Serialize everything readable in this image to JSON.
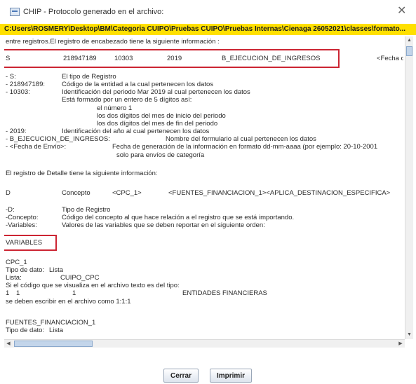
{
  "window": {
    "title": "CHIP - Protocolo generado en el archivo:",
    "path": "C:Users\\ROSMERY\\Desktop\\BM\\Categoria CUIPO\\Pruebas CUIPO\\Pruebas Internas\\Cienaga 26052021\\classes\\formato..."
  },
  "content": {
    "intro": "entre registros.El registro de encabezado tiene la siguiente información :",
    "header_record": {
      "c1": "S",
      "c2": "218947189",
      "c3": "10303",
      "c4": "2019",
      "c5": "B_EJECUCION_DE_INGRESOS",
      "c6": "<Fecha d"
    },
    "header_fields": [
      {
        "key": "- S:",
        "desc": "El tipo de Registro"
      },
      {
        "key": "- 218947189:",
        "desc": "Código de la entidad a la cual pertenecen los datos"
      },
      {
        "key": "- 10303:",
        "desc": "Identificación del periodo Mar 2019 al cual pertenecen los datos"
      }
    ],
    "period_note": {
      "line1": "Está formado por un entero de 5 dígitos así:",
      "line2": "el número 1",
      "line3": "los dos dígitos del mes de inicio del periodo",
      "line4": "los dos dígitos del mes de fin del periodo"
    },
    "year_field": {
      "key": "- 2019:",
      "desc": "Identificación del año al cual pertenecen los datos"
    },
    "form_field": {
      "key": "- B_EJECUCION_DE_INGRESOS:",
      "desc": "Nombre del formulario al cual pertenecen los datos"
    },
    "date_field": {
      "key": "- <Fecha de Envío>:",
      "desc": "Fecha de generación de la información en formato dd-mm-aaaa (por ejemplo: 20-10-2001",
      "desc2": "solo para envíos de categoría"
    },
    "detail_intro": "El registro de Detalle tiene la siguiente información:",
    "detail_record": {
      "c1": "D",
      "c2": "Concepto",
      "c3": "<CPC_1>",
      "c4": "<FUENTES_FINANCIACION_1><APLICA_DESTINACION_ESPECIFICA>"
    },
    "detail_fields": [
      {
        "key": "-D:",
        "desc": "Tipo de Registro"
      },
      {
        "key": "-Concepto:",
        "desc": "Código del concepto al que hace relación a  el registro que se está importando."
      },
      {
        "key": "-Variables:",
        "desc": "Valores de las variables que se deben reportar en el siguiente orden:"
      }
    ],
    "variables_heading": "VARIABLES",
    "cpc": {
      "name": "CPC_1",
      "type_label": "Tipo de dato:",
      "type_value": "Lista",
      "list_label": "Lista:",
      "list_value": "CUIPO_CPC",
      "note": "Si el código que se visualiza en el archivo texto es del tipo:",
      "ex_a": "1",
      "ex_b": "1",
      "ex_c": "1",
      "ex_d": "ENTIDADES FINANCIERAS",
      "note2": "se deben escribir en el archivo como 1:1:1"
    },
    "fuentes": {
      "name": "FUENTES_FINANCIACION_1",
      "type_label": "Tipo de dato:",
      "type_value": "Lista"
    }
  },
  "buttons": {
    "close": "Cerrar",
    "print": "Imprimir"
  },
  "colors": {
    "path_bar": "#ffe000",
    "highlight_box": "#cc2533"
  },
  "icons": {
    "app": "chip-window-icon",
    "close": "close-icon"
  }
}
